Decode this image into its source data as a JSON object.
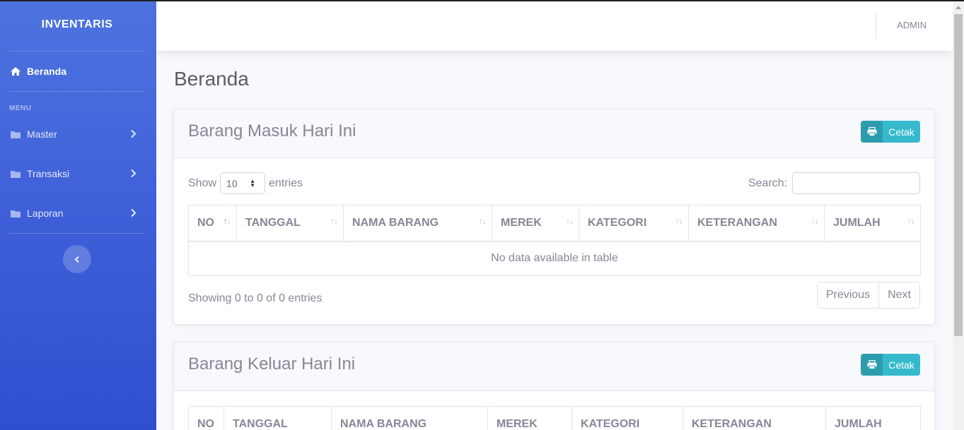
{
  "sidebar": {
    "brand": "INVENTARIS",
    "home_label": "Beranda",
    "menu_heading": "MENU",
    "items": [
      {
        "label": "Master"
      },
      {
        "label": "Transaksi"
      },
      {
        "label": "Laporan"
      }
    ]
  },
  "topbar": {
    "user": "ADMIN"
  },
  "page": {
    "title": "Beranda"
  },
  "cards": [
    {
      "title": "Barang Masuk Hari Ini",
      "print_label": "Cetak",
      "show_label": "Show",
      "entries_value": "10",
      "entries_label": "entries",
      "search_label": "Search:",
      "columns": [
        "NO",
        "TANGGAL",
        "NAMA BARANG",
        "MEREK",
        "KATEGORI",
        "KETERANGAN",
        "JUMLAH"
      ],
      "empty_text": "No data available in table",
      "info": "Showing 0 to 0 of 0 entries",
      "prev_label": "Previous",
      "next_label": "Next"
    },
    {
      "title": "Barang Keluar Hari Ini",
      "print_label": "Cetak",
      "columns": [
        "NO",
        "TANGGAL",
        "NAMA BARANG",
        "MEREK",
        "KATEGORI",
        "KETERANGAN",
        "JUMLAH"
      ]
    }
  ],
  "colors": {
    "sidebar": "#4e73df",
    "accent_info": "#36b9cc"
  },
  "icons": {
    "home": "home-icon",
    "folder": "folder-icon",
    "chevron": "chevron-right-icon",
    "print": "print-icon",
    "collapse": "chevron-left-icon"
  }
}
